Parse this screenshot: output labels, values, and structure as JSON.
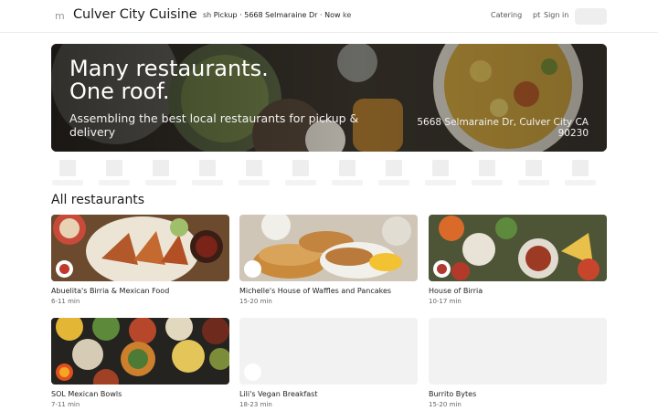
{
  "header": {
    "menu_label": "m",
    "brand": "Culver City Cuisine",
    "mode_prefix": "sh",
    "mode_text": "Pickup · 5668 Selmaraine Dr · Now",
    "mode_suffix": "ke",
    "catering": "Catering",
    "lang": "pt",
    "signin": "Sign in"
  },
  "hero": {
    "title": "Many restaurants.\nOne roof.",
    "subtitle": "Assembling the best local restaurants for pickup & delivery",
    "address": "5668 Selmaraine Dr, Culver City CA 90230"
  },
  "section": {
    "title": "All restaurants"
  },
  "restaurants": [
    {
      "name": "Abuelita's Birria & Mexican Food",
      "time": "6-11 min",
      "logo_color": "#c0392b",
      "has_image": true
    },
    {
      "name": "Michelle's House of Waffles and Pancakes",
      "time": "15-20 min",
      "logo_color": "#ffffff",
      "has_image": true
    },
    {
      "name": "House of Birria",
      "time": "10-17 min",
      "logo_color": "#b03a2e",
      "has_image": true
    },
    {
      "name": "SOL Mexican Bowls",
      "time": "7-11 min",
      "logo_color": "#e0501f",
      "has_image": true
    },
    {
      "name": "Lili's Vegan Breakfast",
      "time": "18-23 min",
      "logo_color": "#ffffff",
      "has_image": false
    },
    {
      "name": "Burrito Bytes",
      "time": "15-20 min",
      "logo_color": "#ffffff",
      "has_image": false
    }
  ]
}
